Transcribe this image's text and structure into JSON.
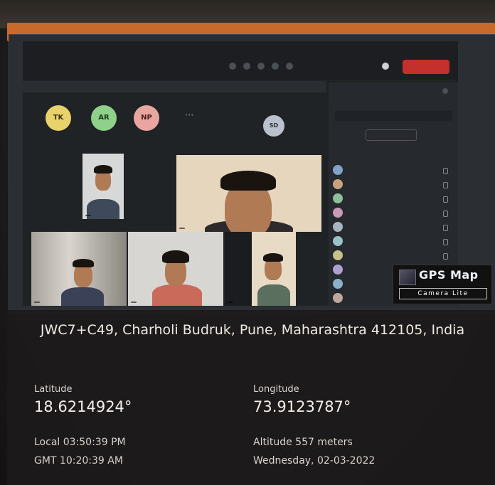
{
  "meeting": {
    "end_label": "",
    "recording_notice": "",
    "dismiss_label": "",
    "participants_title": "",
    "search_placeholder": "",
    "share_invite_label": "",
    "in_meeting_label": "",
    "avatars": [
      {
        "initials": "TK",
        "color": "#e8d36a",
        "text_color": "#3a3210"
      },
      {
        "initials": "AR",
        "color": "#8fd08a",
        "text_color": "#1e3a1a"
      },
      {
        "initials": "NP",
        "color": "#e9a6a0",
        "text_color": "#4a1e1a"
      },
      {
        "initials": "SD",
        "color": "#b9c2cc",
        "text_color": "#2a3038"
      }
    ],
    "participant_rows": 10
  },
  "watermark": {
    "title": "GPS Map",
    "subtitle": "Camera Lite"
  },
  "location": {
    "address": "JWC7+C49, Charholi Budruk, Pune, Maharashtra 412105, India",
    "latitude_label": "Latitude",
    "latitude_value": "18.6214924°",
    "longitude_label": "Longitude",
    "longitude_value": "73.9123787°",
    "local_time": "Local 03:50:39 PM",
    "gmt_time": "GMT 10:20:39 AM",
    "altitude": "Altitude 557 meters",
    "date": "Wednesday, 02-03-2022"
  },
  "colors": {
    "end_button": "#c4302b",
    "taskbar": "#c86a2c"
  }
}
